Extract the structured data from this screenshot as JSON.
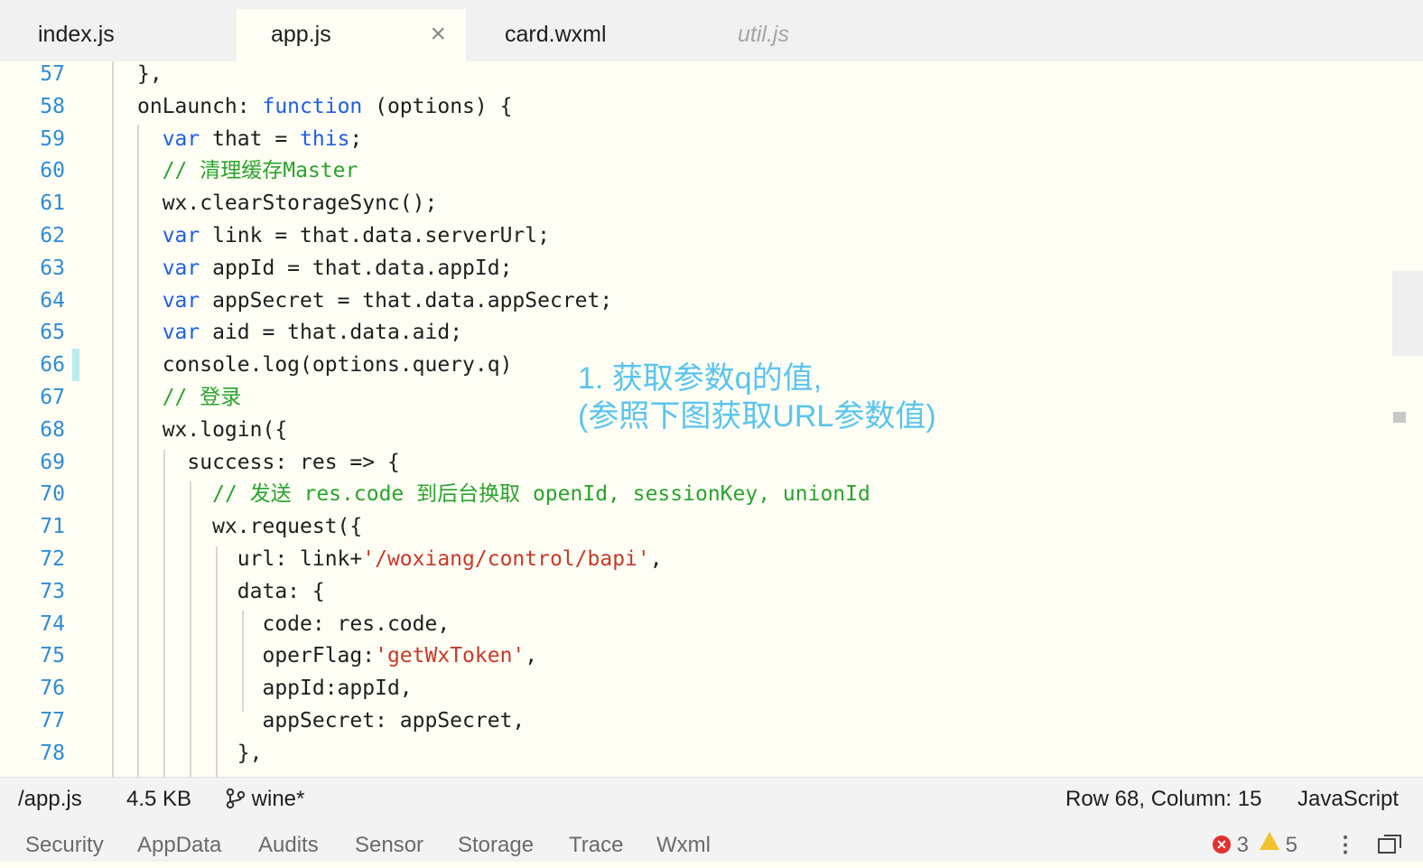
{
  "tabs": [
    {
      "label": "index.js"
    },
    {
      "label": "app.js",
      "close": "×"
    },
    {
      "label": "card.wxml"
    },
    {
      "label": "util.js"
    }
  ],
  "code_lines": [
    {
      "n": "57",
      "t": [
        [
          "p",
          "},"
        ]
      ]
    },
    {
      "n": "58",
      "t": [
        [
          "p",
          "onLaunch: "
        ],
        [
          "kw",
          "function"
        ],
        [
          "p",
          " (options) {"
        ]
      ]
    },
    {
      "n": "59",
      "t": [
        [
          "p",
          "  "
        ],
        [
          "kw",
          "var"
        ],
        [
          "p",
          " that = "
        ],
        [
          "kw",
          "this"
        ],
        [
          "p",
          ";"
        ]
      ]
    },
    {
      "n": "60",
      "t": [
        [
          "p",
          "  "
        ],
        [
          "cm",
          "// 清理缓存Master"
        ]
      ]
    },
    {
      "n": "61",
      "t": [
        [
          "p",
          "  wx.clearStorageSync();"
        ]
      ]
    },
    {
      "n": "62",
      "t": [
        [
          "p",
          "  "
        ],
        [
          "kw",
          "var"
        ],
        [
          "p",
          " link = that.data.serverUrl;"
        ]
      ]
    },
    {
      "n": "63",
      "t": [
        [
          "p",
          "  "
        ],
        [
          "kw",
          "var"
        ],
        [
          "p",
          " appId = that.data.appId;"
        ]
      ]
    },
    {
      "n": "64",
      "t": [
        [
          "p",
          "  "
        ],
        [
          "kw",
          "var"
        ],
        [
          "p",
          " appSecret = that.data.appSecret;"
        ]
      ]
    },
    {
      "n": "65",
      "t": [
        [
          "p",
          "  "
        ],
        [
          "kw",
          "var"
        ],
        [
          "p",
          " aid = that.data.aid;"
        ]
      ]
    },
    {
      "n": "66",
      "t": [
        [
          "p",
          "  console.log(options.query.q)"
        ]
      ]
    },
    {
      "n": "67",
      "t": [
        [
          "p",
          "  "
        ],
        [
          "cm",
          "// 登录"
        ]
      ]
    },
    {
      "n": "68",
      "t": [
        [
          "p",
          "  wx.login({"
        ]
      ]
    },
    {
      "n": "69",
      "t": [
        [
          "p",
          "    success: res => {"
        ]
      ]
    },
    {
      "n": "70",
      "t": [
        [
          "p",
          "      "
        ],
        [
          "cm",
          "// 发送 res.code 到后台换取 openId, sessionKey, unionId"
        ]
      ]
    },
    {
      "n": "71",
      "t": [
        [
          "p",
          "      wx.request({"
        ]
      ]
    },
    {
      "n": "72",
      "t": [
        [
          "p",
          "        url: link+"
        ],
        [
          "st",
          "'/woxiang/control/bapi'"
        ],
        [
          "p",
          ","
        ]
      ]
    },
    {
      "n": "73",
      "t": [
        [
          "p",
          "        data: {"
        ]
      ]
    },
    {
      "n": "74",
      "t": [
        [
          "p",
          "          code: res.code,"
        ]
      ]
    },
    {
      "n": "75",
      "t": [
        [
          "p",
          "          operFlag:"
        ],
        [
          "st",
          "'getWxToken'"
        ],
        [
          "p",
          ","
        ]
      ]
    },
    {
      "n": "76",
      "t": [
        [
          "p",
          "          appId:appId,"
        ]
      ]
    },
    {
      "n": "77",
      "t": [
        [
          "p",
          "          appSecret: appSecret,"
        ]
      ]
    },
    {
      "n": "78",
      "t": [
        [
          "p",
          "        },"
        ]
      ]
    }
  ],
  "annotation": {
    "line1": "1. 获取参数q的值,",
    "line2": "(参照下图获取URL参数值)",
    "color": "#59c4ef"
  },
  "status": {
    "path": "/app.js",
    "size": "4.5 KB",
    "branch": "wine*",
    "position": "Row 68, Column: 15",
    "language": "JavaScript"
  },
  "panel_tabs": [
    "Security",
    "AppData",
    "Audits",
    "Sensor",
    "Storage",
    "Trace",
    "Wxml"
  ],
  "counts": {
    "errors": "3",
    "warnings": "5"
  },
  "colors": {
    "keyword": "#1f5ee8",
    "comment": "#2aa32f",
    "string": "#c7392a",
    "line_number": "#2f8bd6"
  }
}
